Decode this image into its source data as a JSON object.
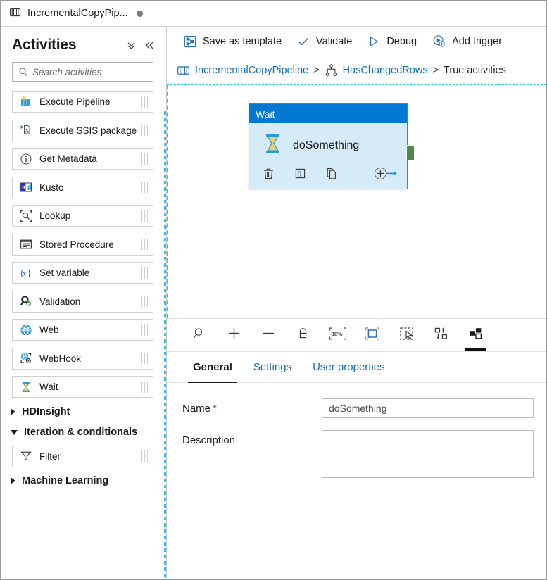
{
  "tab": {
    "icon": "pipeline-icon",
    "label": "IncrementalCopyPip...",
    "unsaved_indicator": "●"
  },
  "sidebar": {
    "title": "Activities",
    "collapse_all_icon": "chevron-double-down-icon",
    "collapse_panel_icon": "chevron-double-left-icon",
    "search": {
      "placeholder": "Search activities",
      "value": "",
      "icon": "search-icon"
    },
    "items": [
      {
        "label": "Execute Pipeline",
        "icon": "execute-pipeline-icon",
        "type": "activity"
      },
      {
        "label": "Execute SSIS package",
        "icon": "execute-ssis-package-icon",
        "type": "activity"
      },
      {
        "label": "Get Metadata",
        "icon": "get-metadata-icon",
        "type": "activity"
      },
      {
        "label": "Kusto",
        "icon": "kusto-icon",
        "type": "activity"
      },
      {
        "label": "Lookup",
        "icon": "lookup-icon",
        "type": "activity"
      },
      {
        "label": "Stored Procedure",
        "icon": "stored-procedure-icon",
        "type": "activity"
      },
      {
        "label": "Set variable",
        "icon": "set-variable-icon",
        "type": "activity"
      },
      {
        "label": "Validation",
        "icon": "validation-icon",
        "type": "activity"
      },
      {
        "label": "Web",
        "icon": "web-icon",
        "type": "activity"
      },
      {
        "label": "WebHook",
        "icon": "webhook-icon",
        "type": "activity"
      },
      {
        "label": "Wait",
        "icon": "wait-icon",
        "type": "activity"
      },
      {
        "label": "HDInsight",
        "icon": "chevron-right-icon",
        "type": "group",
        "expanded": false
      },
      {
        "label": "Iteration & conditionals",
        "icon": "chevron-down-icon",
        "type": "group",
        "expanded": true
      },
      {
        "label": "Filter",
        "icon": "filter-icon",
        "type": "activity"
      },
      {
        "label": "Machine Learning",
        "icon": "chevron-right-icon",
        "type": "group",
        "expanded": false
      }
    ]
  },
  "commandbar": {
    "items": [
      {
        "label": "Save as template",
        "icon": "save-as-template-icon"
      },
      {
        "label": "Validate",
        "icon": "checkmark-icon"
      },
      {
        "label": "Debug",
        "icon": "play-triangle-icon"
      },
      {
        "label": "Add trigger",
        "icon": "add-trigger-icon"
      }
    ]
  },
  "breadcrumb": {
    "pipeline_icon": "pipeline-icon",
    "pipeline": "IncrementalCopyPipeline",
    "separator1": ">",
    "condition_icon": "if-condition-icon",
    "condition": "HasChangedRows",
    "separator2": ">",
    "current": "True activities"
  },
  "canvas": {
    "node": {
      "type_label": "Wait",
      "name": "doSomething",
      "type_icon": "wait-hourglass-icon",
      "actions": [
        {
          "name": "delete-activity",
          "icon": "trash-icon"
        },
        {
          "name": "view-code",
          "icon": "code-braces-icon"
        },
        {
          "name": "clone-activity",
          "icon": "copy-icon"
        },
        {
          "name": "add-output",
          "icon": "add-output-arrow-icon"
        }
      ],
      "output_port": "success-output-port"
    },
    "tools": [
      {
        "name": "zoom-tool",
        "icon": "magnifier-icon",
        "active": false
      },
      {
        "name": "zoom-in",
        "icon": "plus-icon",
        "active": false
      },
      {
        "name": "zoom-out",
        "icon": "minus-icon",
        "active": false
      },
      {
        "name": "lock-canvas",
        "icon": "lock-icon",
        "active": false
      },
      {
        "name": "zoom-to-100",
        "icon": "zoom-100-percent-icon",
        "label": "00%",
        "active": false
      },
      {
        "name": "zoom-to-fit",
        "icon": "zoom-to-fit-icon",
        "active": false
      },
      {
        "name": "select-mode",
        "icon": "marquee-select-icon",
        "active": false
      },
      {
        "name": "auto-align",
        "icon": "auto-align-icon",
        "active": false
      },
      {
        "name": "show-hide-panel",
        "icon": "layout-panel-icon",
        "active": true
      }
    ]
  },
  "properties": {
    "tabs": [
      {
        "label": "General",
        "selected": true
      },
      {
        "label": "Settings",
        "selected": false
      },
      {
        "label": "User properties",
        "selected": false
      }
    ],
    "fields": {
      "name_label": "Name",
      "name_required": "*",
      "name_value": "doSomething",
      "description_label": "Description",
      "description_value": ""
    }
  },
  "colors": {
    "accent": "#0078d4",
    "link": "#0f6cbd",
    "node_body": "#d6ebf8",
    "node_border": "#2b88d8",
    "port_green": "#4c8c4a",
    "dropzone_dash": "#1ec8f0",
    "required_red": "#a4262c"
  }
}
